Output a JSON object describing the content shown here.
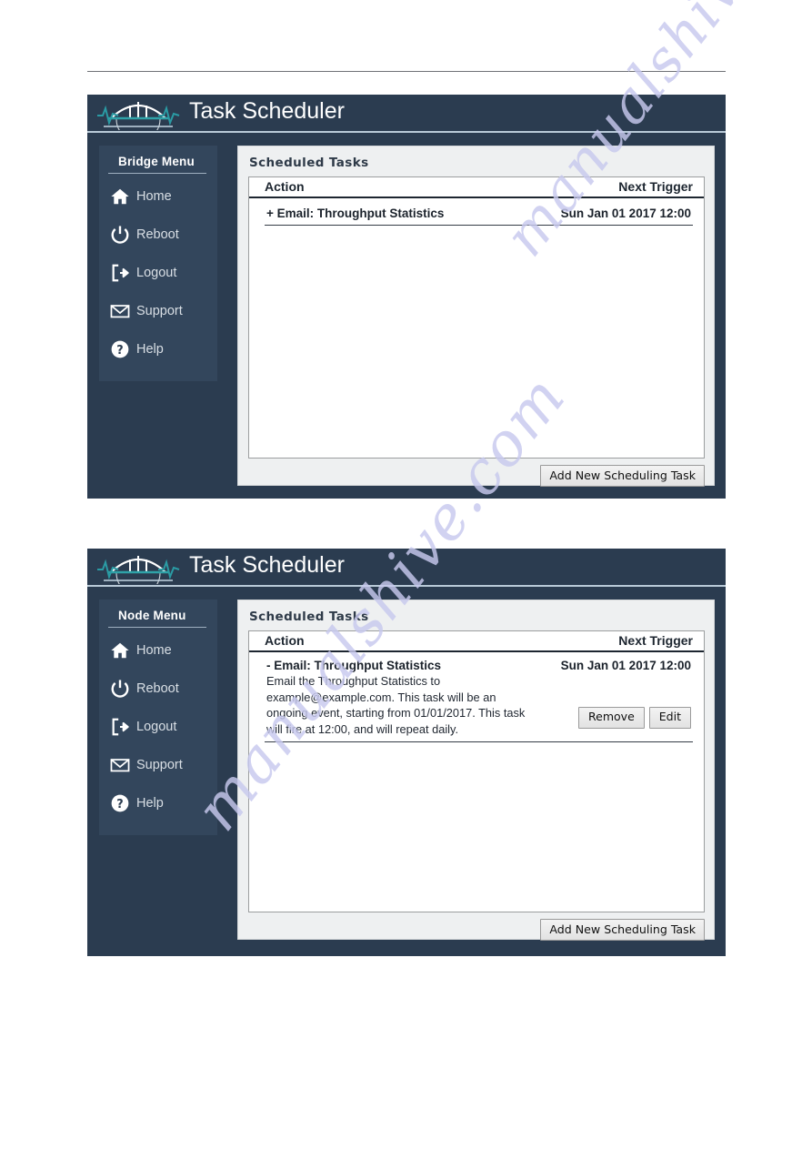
{
  "app": {
    "title": "Task Scheduler",
    "logo_icon": "bridge-pulse-logo"
  },
  "watermark": {
    "text": "manualshive.com"
  },
  "panels": [
    {
      "id": "bridge",
      "menu_title": "Bridge Menu",
      "menu_items": [
        {
          "label": "Home",
          "icon": "home-icon"
        },
        {
          "label": "Reboot",
          "icon": "power-icon"
        },
        {
          "label": "Logout",
          "icon": "logout-icon"
        },
        {
          "label": "Support",
          "icon": "envelope-icon"
        },
        {
          "label": "Help",
          "icon": "question-circle-icon"
        }
      ],
      "content_title": "Scheduled Tasks",
      "table": {
        "headers": [
          "Action",
          "Next Trigger"
        ],
        "rows": [
          {
            "toggle": "+",
            "name": "Email: Throughput Statistics",
            "trigger": "Sun Jan 01 2017 12:00",
            "expanded": false,
            "description": "",
            "actions": []
          }
        ]
      },
      "footer_button": "Add New Scheduling Task"
    },
    {
      "id": "node",
      "menu_title": "Node Menu",
      "menu_items": [
        {
          "label": "Home",
          "icon": "home-icon"
        },
        {
          "label": "Reboot",
          "icon": "power-icon"
        },
        {
          "label": "Logout",
          "icon": "logout-icon"
        },
        {
          "label": "Support",
          "icon": "envelope-icon"
        },
        {
          "label": "Help",
          "icon": "question-circle-icon"
        }
      ],
      "content_title": "Scheduled Tasks",
      "table": {
        "headers": [
          "Action",
          "Next Trigger"
        ],
        "rows": [
          {
            "toggle": "-",
            "name": "Email: Throughput Statistics",
            "trigger": "Sun Jan 01 2017 12:00",
            "expanded": true,
            "description": "Email the Throughput Statistics to example@example.com. This task will be an ongoing event, starting from 01/01/2017. This task will fire at 12:00, and will repeat daily.",
            "actions": [
              "Remove",
              "Edit"
            ]
          }
        ]
      },
      "footer_button": "Add New Scheduling Task"
    }
  ],
  "colors": {
    "panel_navy": "#2b3c50",
    "sidebar_navy": "#33465c",
    "accent_teal": "#2fa2a8",
    "content_grey": "#eef0f1",
    "watermark": "#c8c9ee"
  }
}
